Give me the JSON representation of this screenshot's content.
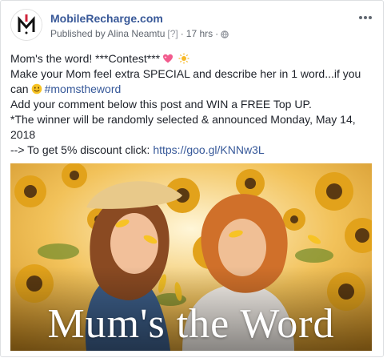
{
  "header": {
    "page_name": "MobileRecharge.com",
    "published_by": "Published by Alina Neamtu",
    "question_mark": "[?]",
    "separator": "·",
    "time": "17 hrs",
    "avatar_icon": "mobilerecharge-logo-icon",
    "privacy_icon": "globe-icon",
    "more_icon": "more-options-icon"
  },
  "post": {
    "line1_text": "Mom's the word! ***Contest***",
    "line1_emojis": [
      "sparkling-heart-icon",
      "sun-icon"
    ],
    "line2_text": "Make your Mom feel extra SPECIAL and describe her in 1 word...if you",
    "line3_prefix": "can",
    "line3_emoji": "smiling-face-icon",
    "line3_hashtag": "#momstheword",
    "line4_text": "Add your comment below this post and WIN a FREE Top UP.",
    "line5_text": "*The winner will be randomly selected & announced Monday, May 14, 2018",
    "line6_prefix": "--> To get 5% discount click:",
    "line6_link": "https://goo.gl/KNNw3L"
  },
  "photo": {
    "caption": "Mum's the Word",
    "description_icon": "sunflower-field-photo"
  },
  "colors": {
    "link": "#365899",
    "page_name": "#385898",
    "text": "#1d2129",
    "meta": "#616770"
  }
}
